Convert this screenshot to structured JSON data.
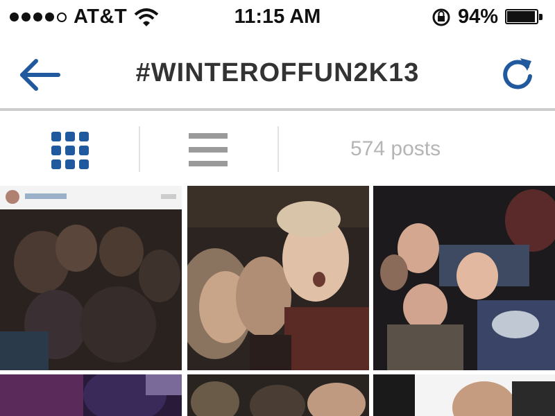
{
  "status_bar": {
    "carrier": "AT&T",
    "time": "11:15 AM",
    "battery_percent": "94%",
    "signal_bars": 4
  },
  "nav": {
    "title": "#WINTEROFFUN2K13",
    "back_icon": "arrow-left-icon",
    "refresh_icon": "refresh-icon",
    "accent_color": "#21599e"
  },
  "toolbar": {
    "views": [
      "grid-view",
      "list-view"
    ],
    "selected_view": "grid-view",
    "post_count": "574 posts"
  },
  "photos": [
    {
      "id": "photo-1",
      "subject": "dark group photo"
    },
    {
      "id": "photo-2",
      "subject": "selfie of two people"
    },
    {
      "id": "photo-3",
      "subject": "group of boys"
    },
    {
      "id": "photo-4",
      "subject": "partial"
    },
    {
      "id": "photo-5",
      "subject": "partial"
    },
    {
      "id": "photo-6",
      "subject": "partial"
    }
  ]
}
